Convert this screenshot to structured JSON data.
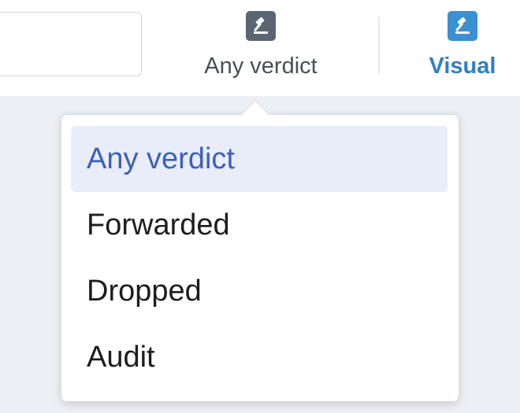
{
  "toolbar": {
    "search": {
      "value": "",
      "placeholder": ""
    },
    "verdict_button": {
      "label": "Any verdict",
      "icon": "gavel-icon",
      "icon_bg": "#5a6772",
      "label_color": "#4a4f55"
    },
    "visual_button": {
      "label": "Visual",
      "icon": "gavel-icon",
      "icon_bg": "#3b8fd3",
      "label_color": "#2f7fc3"
    }
  },
  "verdict_menu": {
    "selected_index": 0,
    "accent": "#3d5fbd",
    "selected_bg": "#e8edf9",
    "items": [
      {
        "label": "Any verdict"
      },
      {
        "label": "Forwarded"
      },
      {
        "label": "Dropped"
      },
      {
        "label": "Audit"
      }
    ]
  }
}
